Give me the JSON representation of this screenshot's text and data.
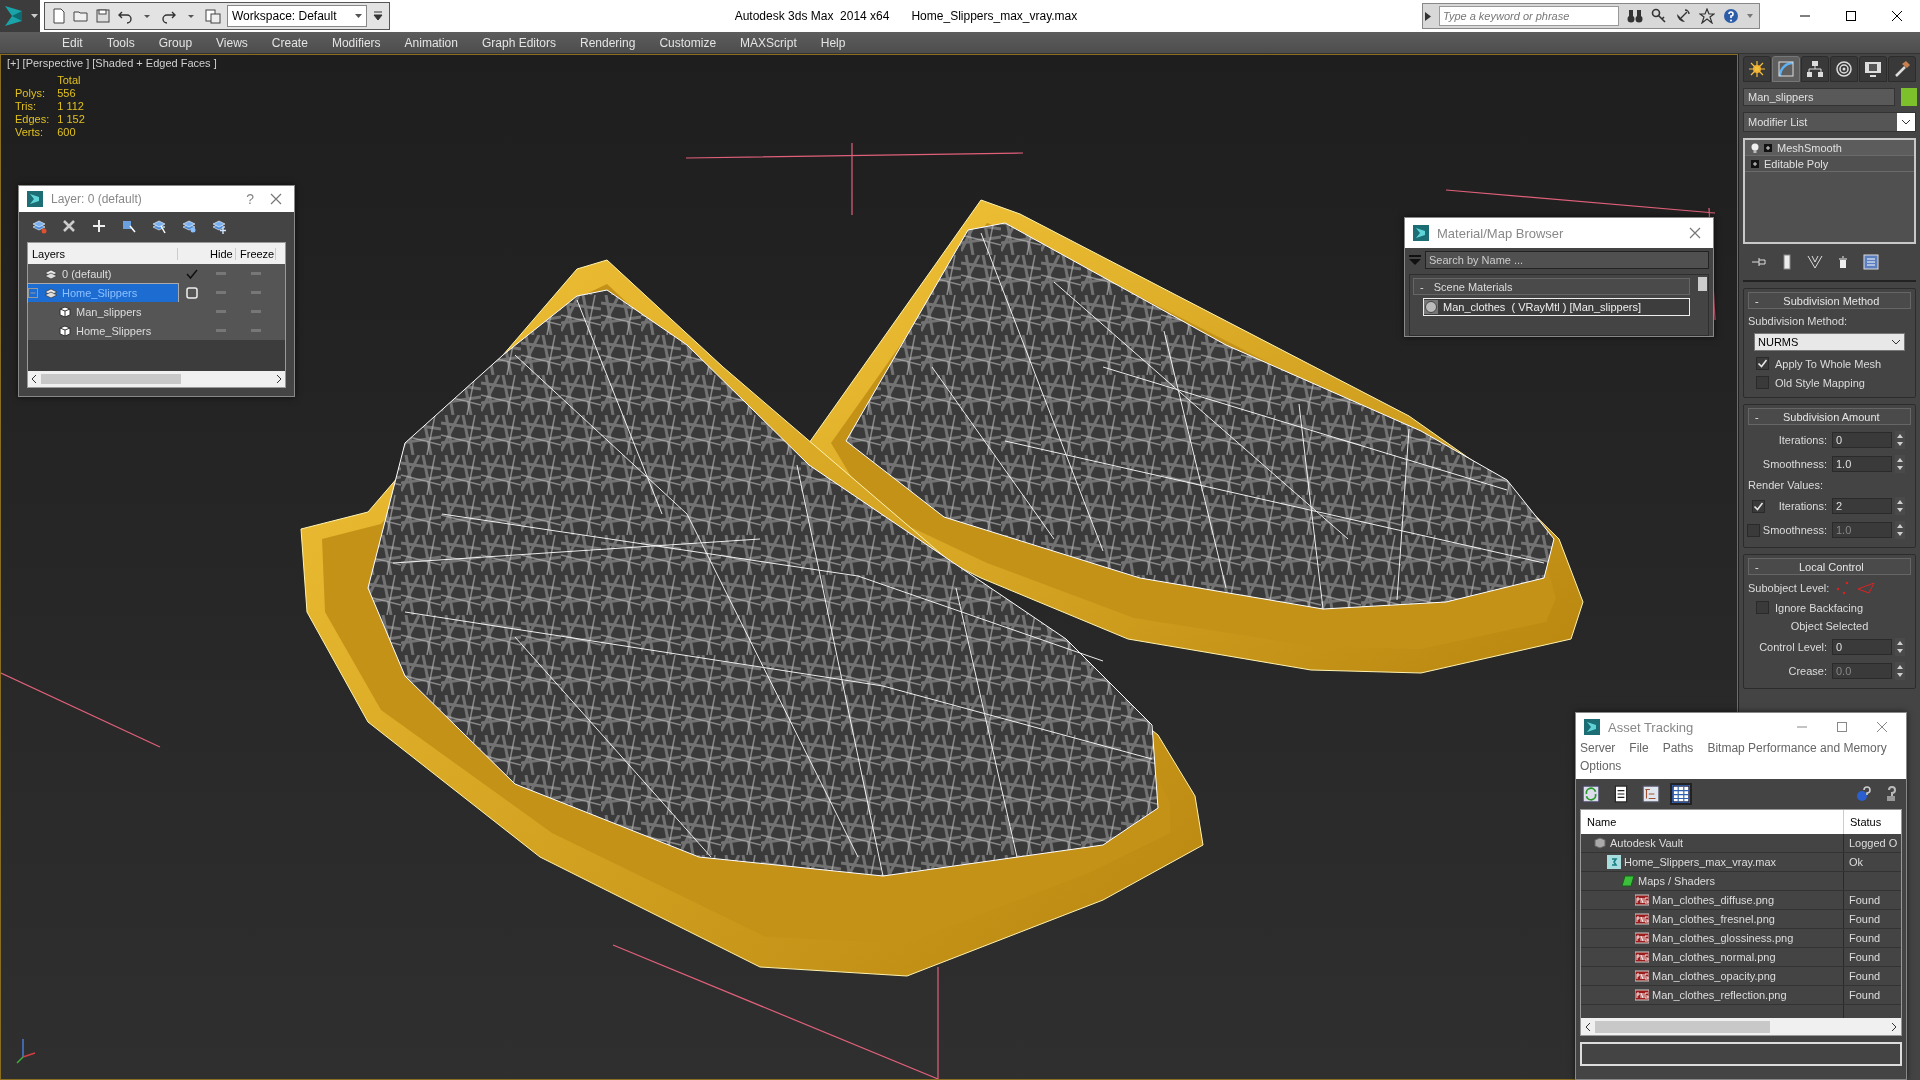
{
  "title_bar": {
    "workspace": "Workspace: Default",
    "app_title": "Autodesk 3ds Max  2014 x64",
    "file_name": "Home_Slippers_max_vray.max",
    "search": {
      "placeholder": "Type a keyword or phrase"
    }
  },
  "menu_bar": [
    "Edit",
    "Tools",
    "Group",
    "Views",
    "Create",
    "Modifiers",
    "Animation",
    "Graph Editors",
    "Rendering",
    "Customize",
    "MAXScript",
    "Help"
  ],
  "viewport": {
    "label": "[+] [Perspective ] [Shaded + Edged Faces ]",
    "stats": {
      "heading": "Total",
      "rows": [
        {
          "label": "Polys:",
          "value": "556"
        },
        {
          "label": "Tris:",
          "value": "1 112"
        },
        {
          "label": "Edges:",
          "value": "1 152"
        },
        {
          "label": "Verts:",
          "value": "600"
        }
      ]
    }
  },
  "layer_dialog": {
    "title": "Layer: 0 (default)",
    "help": "?",
    "columns": [
      "Layers",
      "Hide",
      "Freeze"
    ],
    "rows": [
      {
        "name": "0 (default)",
        "selected": false,
        "current": true,
        "children": []
      },
      {
        "name": "Home_Slippers",
        "selected": true,
        "current": false,
        "children": [
          {
            "name": "Man_slippers"
          },
          {
            "name": "Home_Slippers"
          }
        ]
      }
    ]
  },
  "material_browser": {
    "title": "Material/Map Browser",
    "search": {
      "placeholder": "Search by Name ..."
    },
    "group": "Scene Materials",
    "group_sign": "-",
    "items": [
      {
        "name": "Man_clothes  ( VRayMtl ) [Man_slippers]",
        "selected": true
      }
    ]
  },
  "command_panel": {
    "tabs": [
      {
        "kind": "create",
        "selected": false
      },
      {
        "kind": "modify",
        "selected": true
      },
      {
        "kind": "hierarchy",
        "selected": false
      },
      {
        "kind": "motion",
        "selected": false
      },
      {
        "kind": "display",
        "selected": false
      },
      {
        "kind": "utilities",
        "selected": false
      }
    ],
    "object_name": "Man_slippers",
    "modifier_list": "Modifier List",
    "stack": [
      {
        "name": "MeshSmooth",
        "kind": "modifier",
        "selected": true
      },
      {
        "name": "Editable Poly",
        "kind": "base",
        "selected": false
      }
    ],
    "rollouts": [
      {
        "sign": "-",
        "title": "Subdivision Method",
        "controls": [
          {
            "kind": "label",
            "text": "Subdivision Method:"
          },
          {
            "kind": "dropdown",
            "value": "NURMS"
          },
          {
            "kind": "checkbox",
            "label": "Apply To Whole Mesh",
            "checked": true
          },
          {
            "kind": "checkbox",
            "label": "Old Style Mapping",
            "checked": false
          }
        ]
      },
      {
        "sign": "-",
        "title": "Subdivision Amount",
        "controls": [
          {
            "kind": "spinner",
            "label": "Iterations:",
            "value": "0",
            "disabled": false
          },
          {
            "kind": "spinner",
            "label": "Smoothness:",
            "value": "1.0",
            "disabled": false
          },
          {
            "kind": "label",
            "text": "Render Values:"
          },
          {
            "kind": "check-spinner",
            "label": "Iterations:",
            "value": "2",
            "checked": true,
            "disabled": false
          },
          {
            "kind": "check-spinner",
            "label": "Smoothness:",
            "value": "1.0",
            "checked": false,
            "disabled": true
          }
        ]
      },
      {
        "sign": "-",
        "title": "Local Control",
        "controls": [
          {
            "kind": "subobject",
            "text": "Subobject Level:"
          },
          {
            "kind": "checkbox",
            "label": "Ignore Backfacing",
            "checked": false
          },
          {
            "kind": "caption",
            "text": "Object Selected"
          },
          {
            "kind": "spinner",
            "label": "Control Level:",
            "value": "0",
            "disabled": false
          },
          {
            "kind": "spinner",
            "label": "Crease:",
            "value": "0.0",
            "disabled": true
          }
        ]
      }
    ]
  },
  "asset_tracking": {
    "title": "Asset Tracking",
    "menu": [
      "Server",
      "File",
      "Paths",
      "Bitmap Performance and Memory",
      "Options"
    ],
    "toolbar": [
      {
        "kind": "refresh",
        "selected": false
      },
      {
        "kind": "list",
        "selected": false
      },
      {
        "kind": "tree",
        "selected": false
      },
      {
        "kind": "table",
        "selected": true
      }
    ],
    "columns": [
      "Name",
      "Status"
    ],
    "rows": [
      {
        "name": "Autodesk Vault",
        "kind": "vault",
        "status": "Logged O",
        "children": [
          {
            "name": "Home_Slippers_max_vray.max",
            "kind": "max-file",
            "status": "Ok",
            "children": [
              {
                "name": "Maps / Shaders",
                "kind": "maps",
                "children": [
                  {
                    "name": "Man_clothes_diffuse.png",
                    "kind": "png",
                    "status": "Found"
                  },
                  {
                    "name": "Man_clothes_fresnel.png",
                    "kind": "png",
                    "status": "Found"
                  },
                  {
                    "name": "Man_clothes_glossiness.png",
                    "kind": "png",
                    "status": "Found"
                  },
                  {
                    "name": "Man_clothes_normal.png",
                    "kind": "png",
                    "status": "Found"
                  },
                  {
                    "name": "Man_clothes_opacity.png",
                    "kind": "png",
                    "status": "Found"
                  },
                  {
                    "name": "Man_clothes_reflection.png",
                    "kind": "png",
                    "status": "Found"
                  }
                ]
              }
            ]
          }
        ]
      }
    ]
  }
}
